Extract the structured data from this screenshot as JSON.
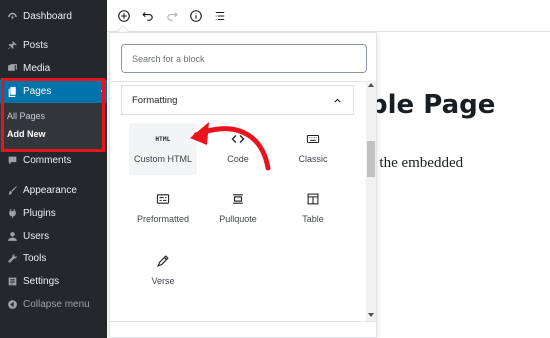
{
  "sidebar": {
    "dashboard": "Dashboard",
    "posts": "Posts",
    "media": "Media",
    "pages": "Pages",
    "all_pages": "All Pages",
    "add_new": "Add New",
    "comments": "Comments",
    "appearance": "Appearance",
    "plugins": "Plugins",
    "users": "Users",
    "tools": "Tools",
    "settings": "Settings",
    "collapse": "Collapse menu"
  },
  "document": {
    "title_fragment": "ple Page",
    "text_fragment": "e the embedded"
  },
  "inserter": {
    "search_placeholder": "Search for a block",
    "panel_title": "Formatting",
    "blocks": [
      {
        "label": "Custom HTML",
        "icon": "html-icon",
        "glyph": "HTML"
      },
      {
        "label": "Code",
        "icon": "code-icon"
      },
      {
        "label": "Classic",
        "icon": "keyboard-icon"
      },
      {
        "label": "Preformatted",
        "icon": "preformatted-icon"
      },
      {
        "label": "Pullquote",
        "icon": "pullquote-icon"
      },
      {
        "label": "Table",
        "icon": "table-icon"
      },
      {
        "label": "Verse",
        "icon": "pen-icon"
      }
    ]
  },
  "colors": {
    "sidebar_bg": "#23282d",
    "active_blue": "#0073aa",
    "highlight_red": "#e7141d"
  }
}
